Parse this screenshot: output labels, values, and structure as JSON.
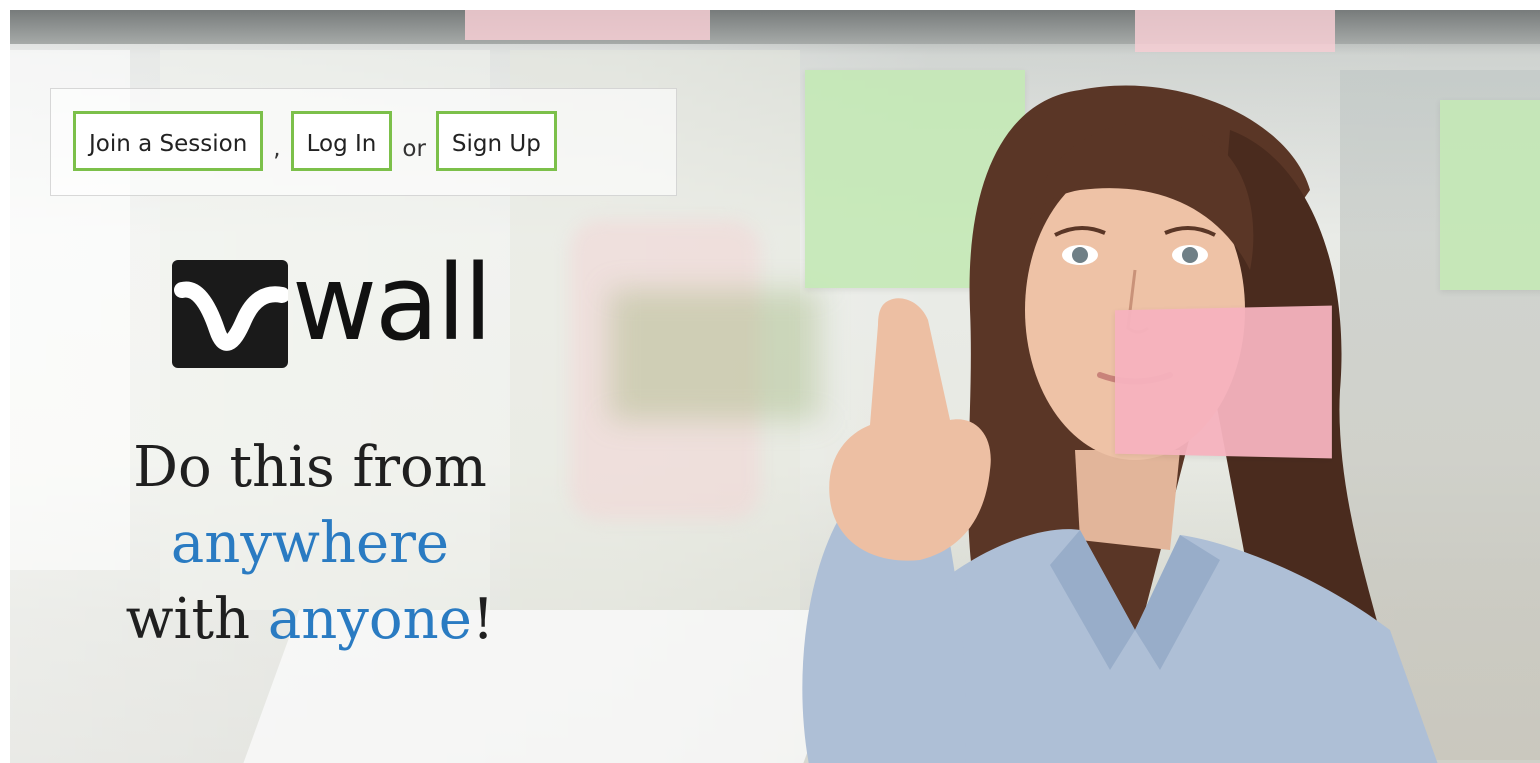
{
  "nav": {
    "join_label": "Join a Session",
    "sep1": ",",
    "login_label": "Log In",
    "sep2": "or",
    "signup_label": "Sign Up"
  },
  "logo": {
    "text": "wall",
    "icon": "v-wave-icon"
  },
  "tagline": {
    "line1": "Do this from",
    "line2": "anywhere",
    "line3_prefix": "with ",
    "line3_highlight": "anyone",
    "line3_suffix": "!"
  },
  "colors": {
    "button_border": "#7cc04a",
    "highlight_text": "#2a7bc2",
    "sticky_green": "#c4e8b6",
    "sticky_pink": "#f5b2be"
  },
  "hero_image": "woman-touching-sticky-notes"
}
